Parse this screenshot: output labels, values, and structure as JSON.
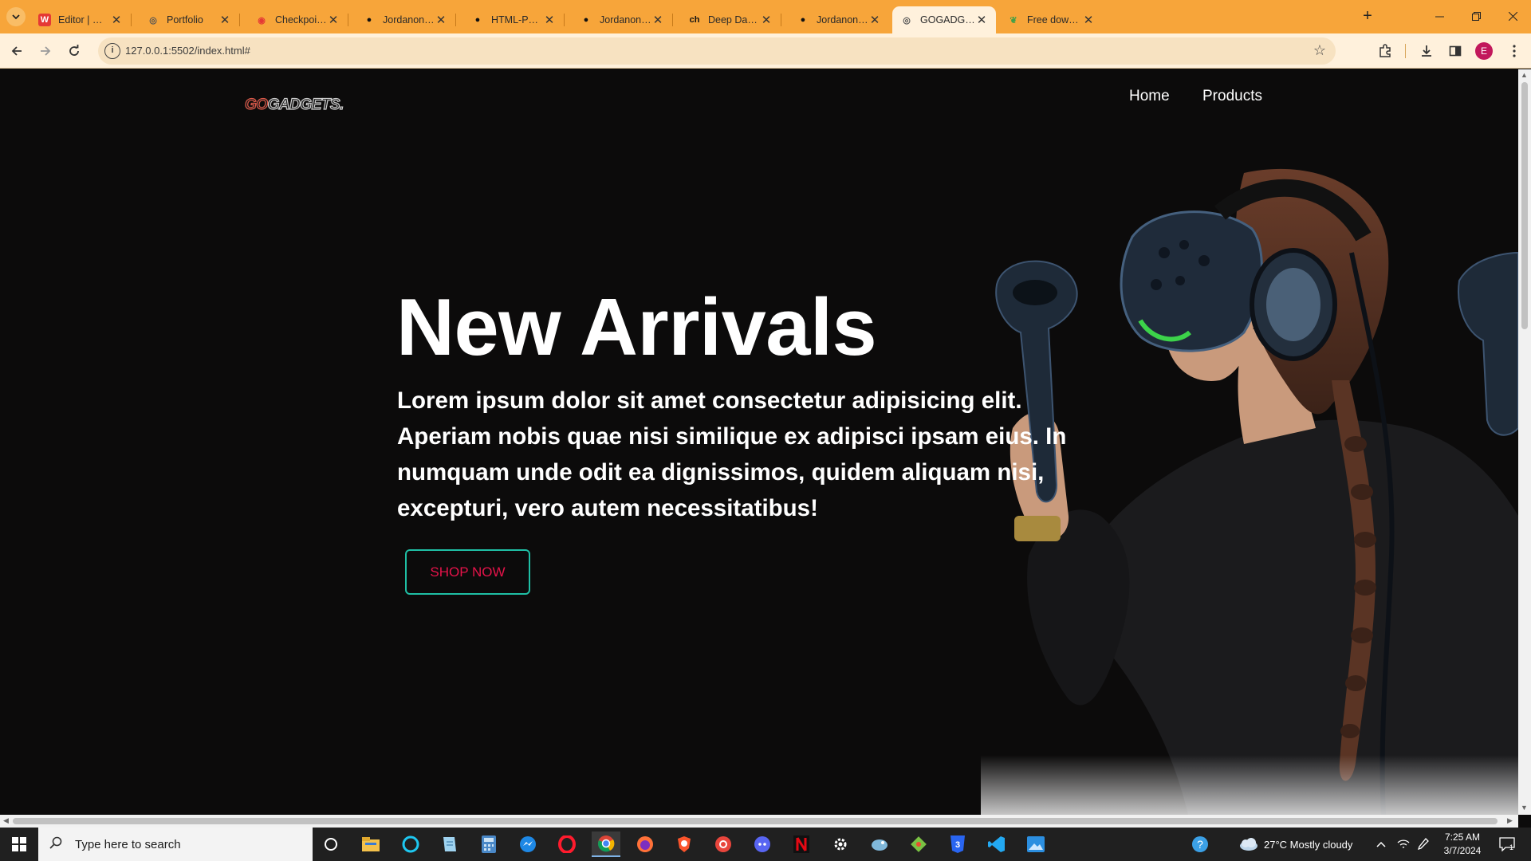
{
  "browser": {
    "tabs": [
      {
        "title": "Editor | Wepik",
        "icon": "wepik-icon",
        "color": "#e53935"
      },
      {
        "title": "Portfolio",
        "icon": "globe-icon",
        "color": "#555555"
      },
      {
        "title": "Checkpoint Detail",
        "icon": "checkpoint-icon",
        "color": "#e53935"
      },
      {
        "title": "Jordanonehunnid",
        "icon": "github-icon",
        "color": "#111111"
      },
      {
        "title": "HTML-PROJECT/a",
        "icon": "github-icon",
        "color": "#111111"
      },
      {
        "title": "Jordanonehunnid",
        "icon": "github-icon",
        "color": "#111111"
      },
      {
        "title": "Deep Dark Color I",
        "icon": "ch-icon",
        "color": "#111111"
      },
      {
        "title": "Jordanonehunnid",
        "icon": "github-icon",
        "color": "#111111"
      },
      {
        "title": "GOGADGETS",
        "icon": "globe-icon",
        "color": "#555555",
        "active": true
      },
      {
        "title": "Free download Be",
        "icon": "leaf-icon",
        "color": "#43a047"
      }
    ],
    "tab_fav_glyphs": [
      "W",
      "◎",
      "◉",
      "●",
      "●",
      "●",
      "ch",
      "●",
      "◎",
      "❦"
    ],
    "url": "127.0.0.1:5502/index.html#",
    "profile_initial": "E",
    "close_glyph": "✕",
    "new_tab_glyph": "+"
  },
  "page": {
    "logo_go": "GO",
    "logo_rest": "GADGETS.",
    "nav": [
      "Home",
      "Products"
    ],
    "hero_title": "New Arrivals",
    "hero_text": "Lorem ipsum dolor sit amet consectetur adipisicing elit. Aperiam nobis quae nisi similique ex adipisci ipsam eius. In numquam unde odit ea dignissimos, quidem aliquam nisi, excepturi, vero autem necessitatibus!",
    "cta": "SHOP NOW",
    "accent_border": "#1fbfa5",
    "accent_text": "#e6134a"
  },
  "taskbar": {
    "search_placeholder": "Type here to search",
    "weather": "27°C  Mostly cloudy",
    "time": "7:25 AM",
    "date": "3/7/2024",
    "apps": [
      "cortana-circle-icon",
      "file-explorer-icon",
      "alexa-icon",
      "notepad-icon",
      "calculator-icon",
      "messenger-icon",
      "opera-icon",
      "chrome-icon",
      "firefox-icon",
      "brave-icon",
      "chrome-alt-icon",
      "discord-icon",
      "netflix-icon",
      "settings-icon",
      "bird-app-icon",
      "git-icon",
      "css3-icon",
      "vscode-icon",
      "photos-icon"
    ]
  }
}
